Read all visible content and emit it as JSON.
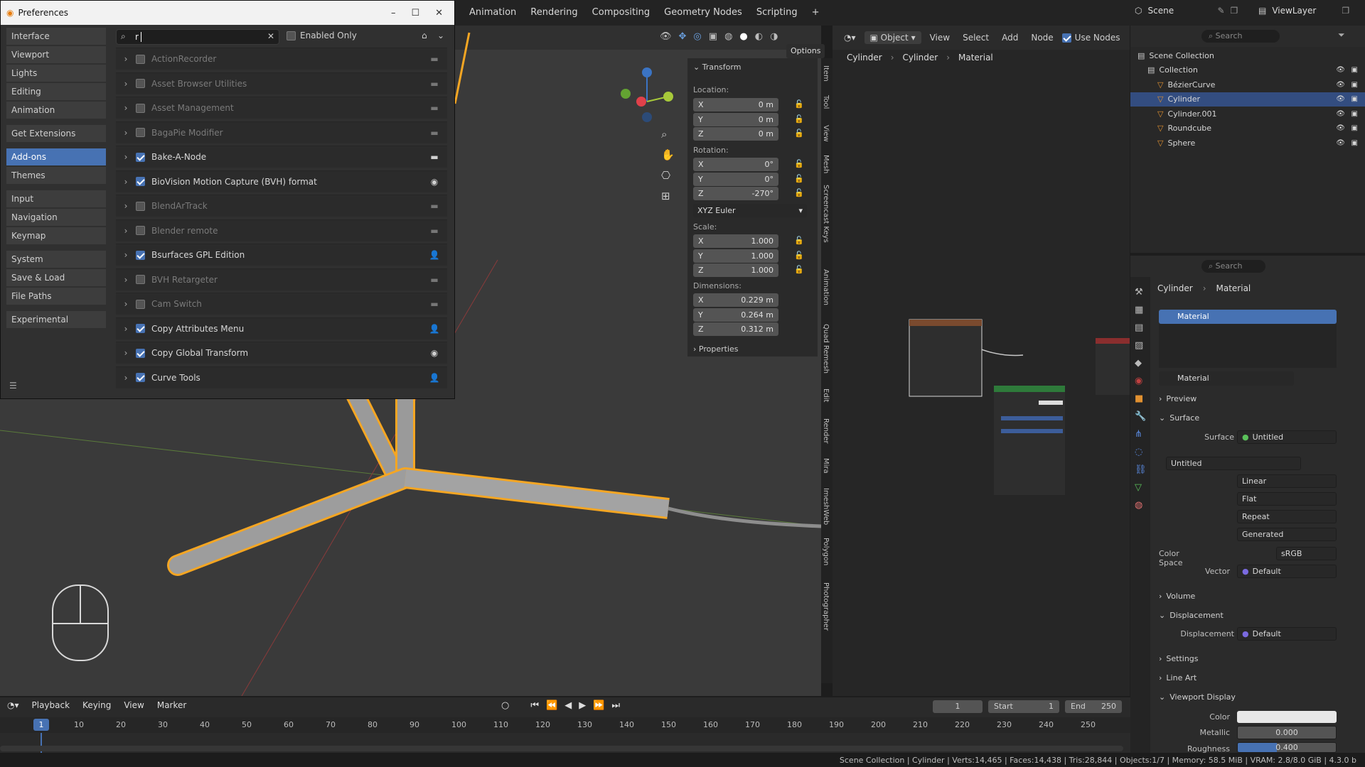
{
  "top_tabs": [
    "Animation",
    "Rendering",
    "Compositing",
    "Geometry Nodes",
    "Scripting",
    "+"
  ],
  "scene": {
    "label": "Scene",
    "view_layer": "ViewLayer"
  },
  "preferences": {
    "title": "Preferences",
    "search_value": "r",
    "enabled_only": "Enabled Only",
    "sidebar": [
      {
        "label": "Interface",
        "active": false,
        "gap": false
      },
      {
        "label": "Viewport",
        "active": false,
        "gap": false
      },
      {
        "label": "Lights",
        "active": false,
        "gap": false
      },
      {
        "label": "Editing",
        "active": false,
        "gap": false
      },
      {
        "label": "Animation",
        "active": false,
        "gap": false
      },
      {
        "label": "Get Extensions",
        "active": false,
        "gap": true
      },
      {
        "label": "Add-ons",
        "active": true,
        "gap": true
      },
      {
        "label": "Themes",
        "active": false,
        "gap": false
      },
      {
        "label": "Input",
        "active": false,
        "gap": true
      },
      {
        "label": "Navigation",
        "active": false,
        "gap": false
      },
      {
        "label": "Keymap",
        "active": false,
        "gap": false
      },
      {
        "label": "System",
        "active": false,
        "gap": true
      },
      {
        "label": "Save & Load",
        "active": false,
        "gap": false
      },
      {
        "label": "File Paths",
        "active": false,
        "gap": false
      },
      {
        "label": "Experimental",
        "active": false,
        "gap": true
      }
    ],
    "addons": [
      {
        "name": "ActionRecorder",
        "enabled": false,
        "icon": "folder-icon"
      },
      {
        "name": "Asset Browser Utilities",
        "enabled": false,
        "icon": "folder-icon"
      },
      {
        "name": "Asset Management",
        "enabled": false,
        "icon": "folder-icon"
      },
      {
        "name": "BagaPie Modifier",
        "enabled": false,
        "icon": "folder-icon"
      },
      {
        "name": "Bake-A-Node",
        "enabled": true,
        "icon": "folder-icon"
      },
      {
        "name": "BioVision Motion Capture (BVH) format",
        "enabled": true,
        "icon": "blender-icon"
      },
      {
        "name": "BlendArTrack",
        "enabled": false,
        "icon": "folder-icon"
      },
      {
        "name": "Blender remote",
        "enabled": false,
        "icon": "folder-icon"
      },
      {
        "name": "Bsurfaces GPL Edition",
        "enabled": true,
        "icon": "user-icon"
      },
      {
        "name": "BVH Retargeter",
        "enabled": false,
        "icon": "folder-icon"
      },
      {
        "name": "Cam Switch",
        "enabled": false,
        "icon": "folder-icon"
      },
      {
        "name": "Copy Attributes Menu",
        "enabled": true,
        "icon": "user-icon"
      },
      {
        "name": "Copy Global Transform",
        "enabled": true,
        "icon": "blender-icon"
      },
      {
        "name": "Curve Tools",
        "enabled": true,
        "icon": "user-icon"
      }
    ]
  },
  "viewport": {
    "options": "Options",
    "object_mode": "Object",
    "menus": [
      "View",
      "Select",
      "Add",
      "Node"
    ],
    "use_nodes": "Use Nodes"
  },
  "transform": {
    "title": "Transform",
    "location_label": "Location:",
    "location": [
      {
        "axis": "X",
        "value": "0 m"
      },
      {
        "axis": "Y",
        "value": "0 m"
      },
      {
        "axis": "Z",
        "value": "0 m"
      }
    ],
    "rotation_label": "Rotation:",
    "rotation": [
      {
        "axis": "X",
        "value": "0°"
      },
      {
        "axis": "Y",
        "value": "0°"
      },
      {
        "axis": "Z",
        "value": "-270°"
      }
    ],
    "rotation_mode": "XYZ Euler",
    "scale_label": "Scale:",
    "scale": [
      {
        "axis": "X",
        "value": "1.000"
      },
      {
        "axis": "Y",
        "value": "1.000"
      },
      {
        "axis": "Z",
        "value": "1.000"
      }
    ],
    "dimensions_label": "Dimensions:",
    "dimensions": [
      {
        "axis": "X",
        "value": "0.229 m"
      },
      {
        "axis": "Y",
        "value": "0.264 m"
      },
      {
        "axis": "Z",
        "value": "0.312 m"
      }
    ],
    "properties": "Properties"
  },
  "side_tabs": [
    "Item",
    "Tool",
    "View",
    "Mesh",
    "Screencast Keys",
    "Animation",
    "Quad Remesh",
    "Edit",
    "Render",
    "Mira",
    "ImeshWeb",
    "Polygon",
    "Photographer"
  ],
  "node_breadcrumb": [
    "Cylinder",
    "Cylinder",
    "Material"
  ],
  "outliner": {
    "search": "Search",
    "items": [
      {
        "label": "Scene Collection",
        "indent": 0,
        "sel": false
      },
      {
        "label": "Collection",
        "indent": 1,
        "sel": false
      },
      {
        "label": "BézierCurve",
        "indent": 2,
        "sel": false
      },
      {
        "label": "Cylinder",
        "indent": 2,
        "sel": true
      },
      {
        "label": "Cylinder.001",
        "indent": 2,
        "sel": false
      },
      {
        "label": "Roundcube",
        "indent": 2,
        "sel": false
      },
      {
        "label": "Sphere",
        "indent": 2,
        "sel": false
      }
    ]
  },
  "properties": {
    "search": "Search",
    "breadcrumb": [
      "Cylinder",
      "Material"
    ],
    "material_slot": "Material",
    "material_name": "Material",
    "sections": {
      "preview": "Preview",
      "surface": "Surface",
      "volume": "Volume",
      "displacement": "Displacement",
      "settings": "Settings",
      "line_art": "Line Art",
      "viewport_display": "Viewport Display"
    },
    "surface_label": "Surface",
    "surface_value": "Untitled",
    "image_name": "Untitled",
    "interp": "Linear",
    "projection": "Flat",
    "extension": "Repeat",
    "source": "Generated",
    "color_space_label": "Color Space",
    "color_space": "sRGB",
    "vector_label": "Vector",
    "vector_value": "Default",
    "displacement_label": "Displacement",
    "displacement_value": "Default",
    "color_label": "Color",
    "metallic_label": "Metallic",
    "metallic": "0.000",
    "roughness_label": "Roughness",
    "roughness": "0.400"
  },
  "timeline": {
    "menus": [
      "Playback",
      "Keying",
      "View",
      "Marker"
    ],
    "frame": "1",
    "start_label": "Start",
    "start": "1",
    "end_label": "End",
    "end": "250",
    "ticks": [
      "10",
      "20",
      "30",
      "40",
      "50",
      "60",
      "70",
      "80",
      "90",
      "100",
      "110",
      "120",
      "130",
      "140",
      "150",
      "160",
      "170",
      "180",
      "190",
      "200",
      "210",
      "220",
      "230",
      "240",
      "250"
    ]
  },
  "status": "Scene Collection | Cylinder | Verts:14,465 | Faces:14,438 | Tris:28,844 | Objects:1/7 | Memory: 58.5 MiB | VRAM: 2.8/8.0 GiB | 4.3.0 b",
  "colors": {
    "accent": "#4772b3",
    "selection": "#f5a623",
    "bg": "#3a3a3a"
  }
}
